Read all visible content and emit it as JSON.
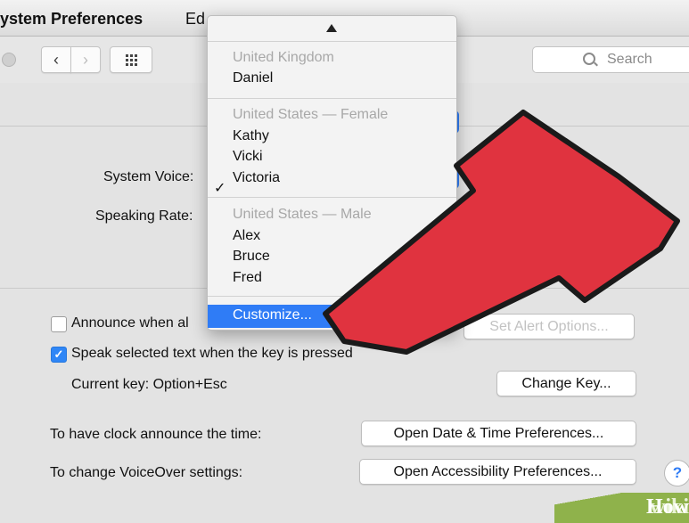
{
  "menubar": {
    "app_name": "ystem Preferences",
    "edit": "Ed"
  },
  "toolbar": {
    "back_icon": "‹",
    "forward_icon": "›",
    "search_placeholder": "Search"
  },
  "content": {
    "system_voice_label": "System Voice:",
    "speaking_rate_label": "Speaking Rate:",
    "announce_label": "Announce when al",
    "announce_checked": false,
    "set_alert_button": "Set Alert Options...",
    "speak_selected_label": "Speak selected text when the key is pressed",
    "speak_selected_checked": true,
    "current_key_label": "Current key: Option+Esc",
    "change_key_button": "Change Key...",
    "clock_label": "To have clock announce the time:",
    "date_time_button": "Open Date & Time Preferences...",
    "voiceover_label": "To change VoiceOver settings:",
    "accessibility_button": "Open Accessibility Preferences...",
    "help_icon": "?"
  },
  "voice_menu": {
    "scroll_up_icon": "▲",
    "uk_header": "United Kingdom",
    "uk_voices": [
      "Daniel"
    ],
    "us_female_header": "United States — Female",
    "us_female_voices": [
      "Kathy",
      "Vicki",
      "Victoria"
    ],
    "checked_voice": "Victoria",
    "checkmark": "✓",
    "us_male_header": "United States — Male",
    "us_male_voices": [
      "Alex",
      "Bruce",
      "Fred"
    ],
    "customize": "Customize..."
  },
  "watermark": {
    "wiki": "wiki",
    "how": "How"
  },
  "colors": {
    "accent": "#2f7cf6",
    "arrow": "#e0333f",
    "watermark": "#8fb24b"
  }
}
